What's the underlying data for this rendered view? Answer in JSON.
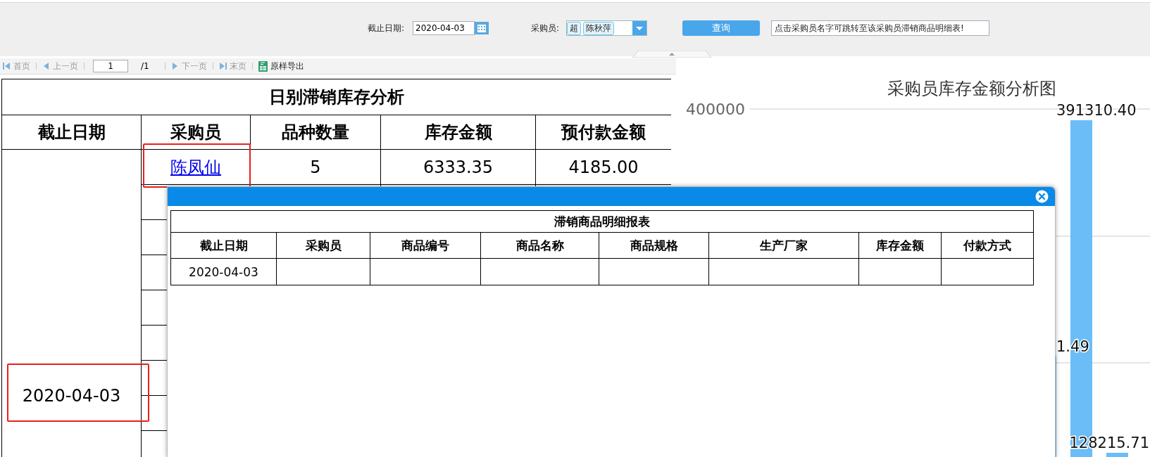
{
  "filter_bar": {
    "date_label": "截止日期:",
    "date_value": "2020-04-03",
    "buyer_label": "采购员:",
    "buyer_chips": [
      "超",
      "陈秋萍"
    ],
    "query_button": "查询",
    "hint": "点击采购员名字可跳转至该采购员滞销商品明细表!"
  },
  "pager": {
    "nav_before": [
      {
        "kind": "first",
        "label": "首页",
        "disabled": true
      },
      {
        "kind": "prev",
        "label": "上一页",
        "disabled": true
      }
    ],
    "page": "1",
    "total": "/1",
    "nav_after": [
      {
        "kind": "next",
        "label": "下一页",
        "disabled": true
      },
      {
        "kind": "last",
        "label": "末页",
        "disabled": true
      },
      {
        "kind": "export",
        "label": "原样导出",
        "disabled": false
      }
    ]
  },
  "report": {
    "title": "日别滞销库存分析",
    "columns": [
      "截止日期",
      "采购员",
      "品种数量",
      "库存金额",
      "预付款金额"
    ],
    "date": "2020-04-03",
    "date_highlighted": true,
    "rows": [
      {
        "buyer": "陈凤仙",
        "count": "5",
        "stock": "6333.35",
        "prepaid": "4185.00",
        "highlighted": true
      }
    ]
  },
  "dialog": {
    "title": "滞销商品明细报表",
    "columns": [
      "截止日期",
      "采购员",
      "商品编号",
      "商品名称",
      "商品规格",
      "生产厂家",
      "库存金额",
      "付款方式"
    ],
    "rows": [
      {
        "cells": [
          "2020-04-03"
        ]
      }
    ]
  },
  "chart": {
    "title": "采购员库存金额分析图",
    "axis_label": "400000",
    "bar_labels": [
      "391310.40",
      "1.49",
      "128215.71"
    ]
  }
}
